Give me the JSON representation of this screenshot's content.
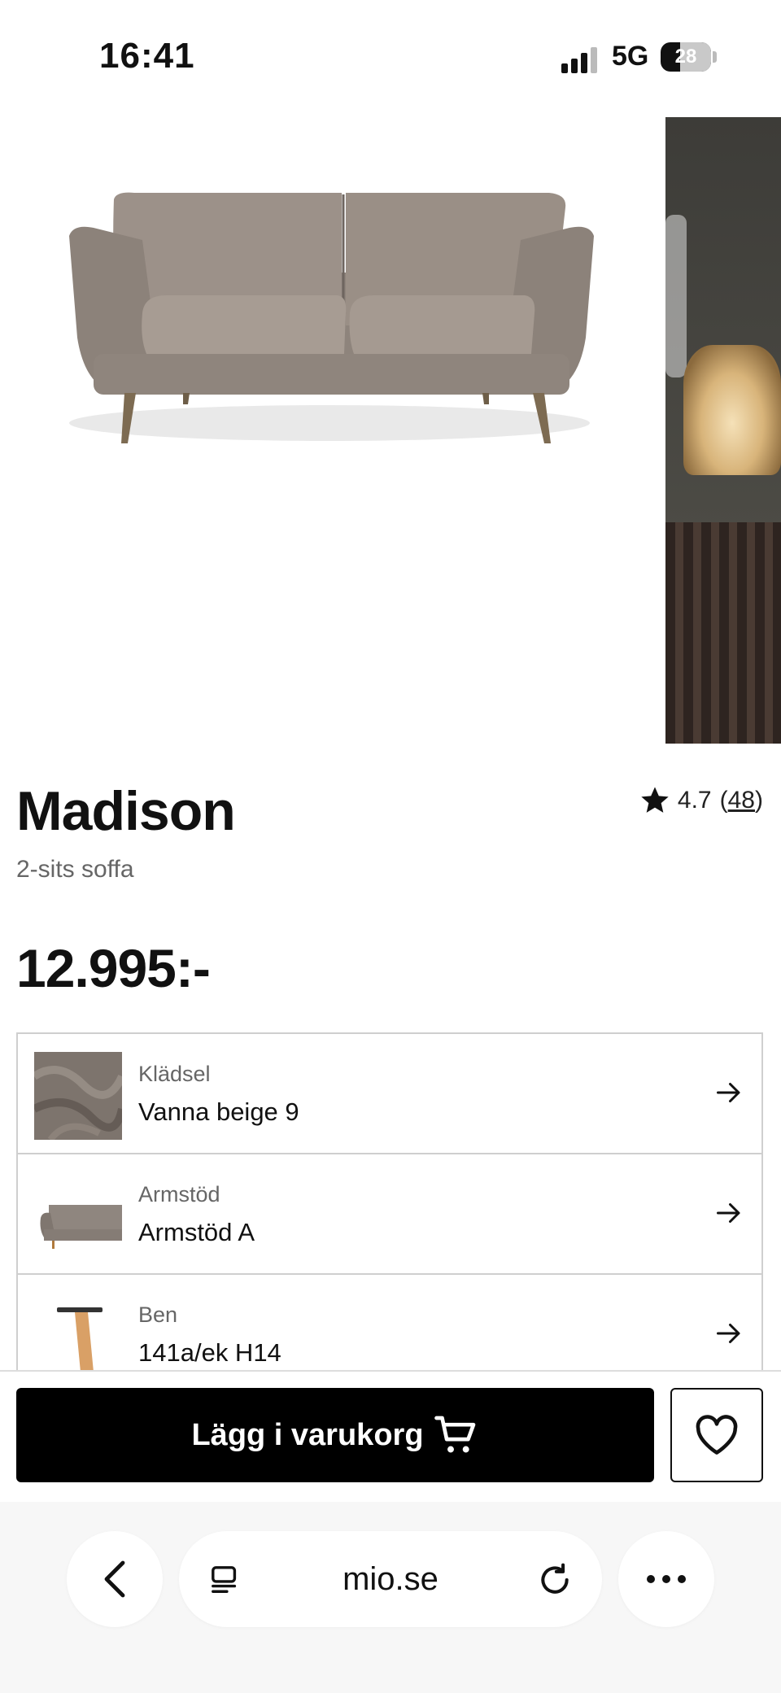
{
  "status_bar": {
    "time": "16:41",
    "network": "5G",
    "battery": "28"
  },
  "product": {
    "name": "Madison",
    "subtitle": "2-sits soffa",
    "price": "12.995:-",
    "rating": "4.7",
    "review_count_open": "(",
    "review_count": "48",
    "review_count_close": ")"
  },
  "options": [
    {
      "label": "Klädsel",
      "value": "Vanna beige 9",
      "thumb": "fabric-swatch"
    },
    {
      "label": "Armstöd",
      "value": "Armstöd A",
      "thumb": "sofa-armrest"
    },
    {
      "label": "Ben",
      "value": "141a/ek H14",
      "thumb": "wooden-leg"
    }
  ],
  "actions": {
    "add_to_cart": "Lägg i varukorg"
  },
  "browser": {
    "url": "mio.se"
  },
  "colors": {
    "cta_bg": "#000000",
    "sofa": "#9a8f86",
    "browser_bg": "#f7f7f7"
  }
}
